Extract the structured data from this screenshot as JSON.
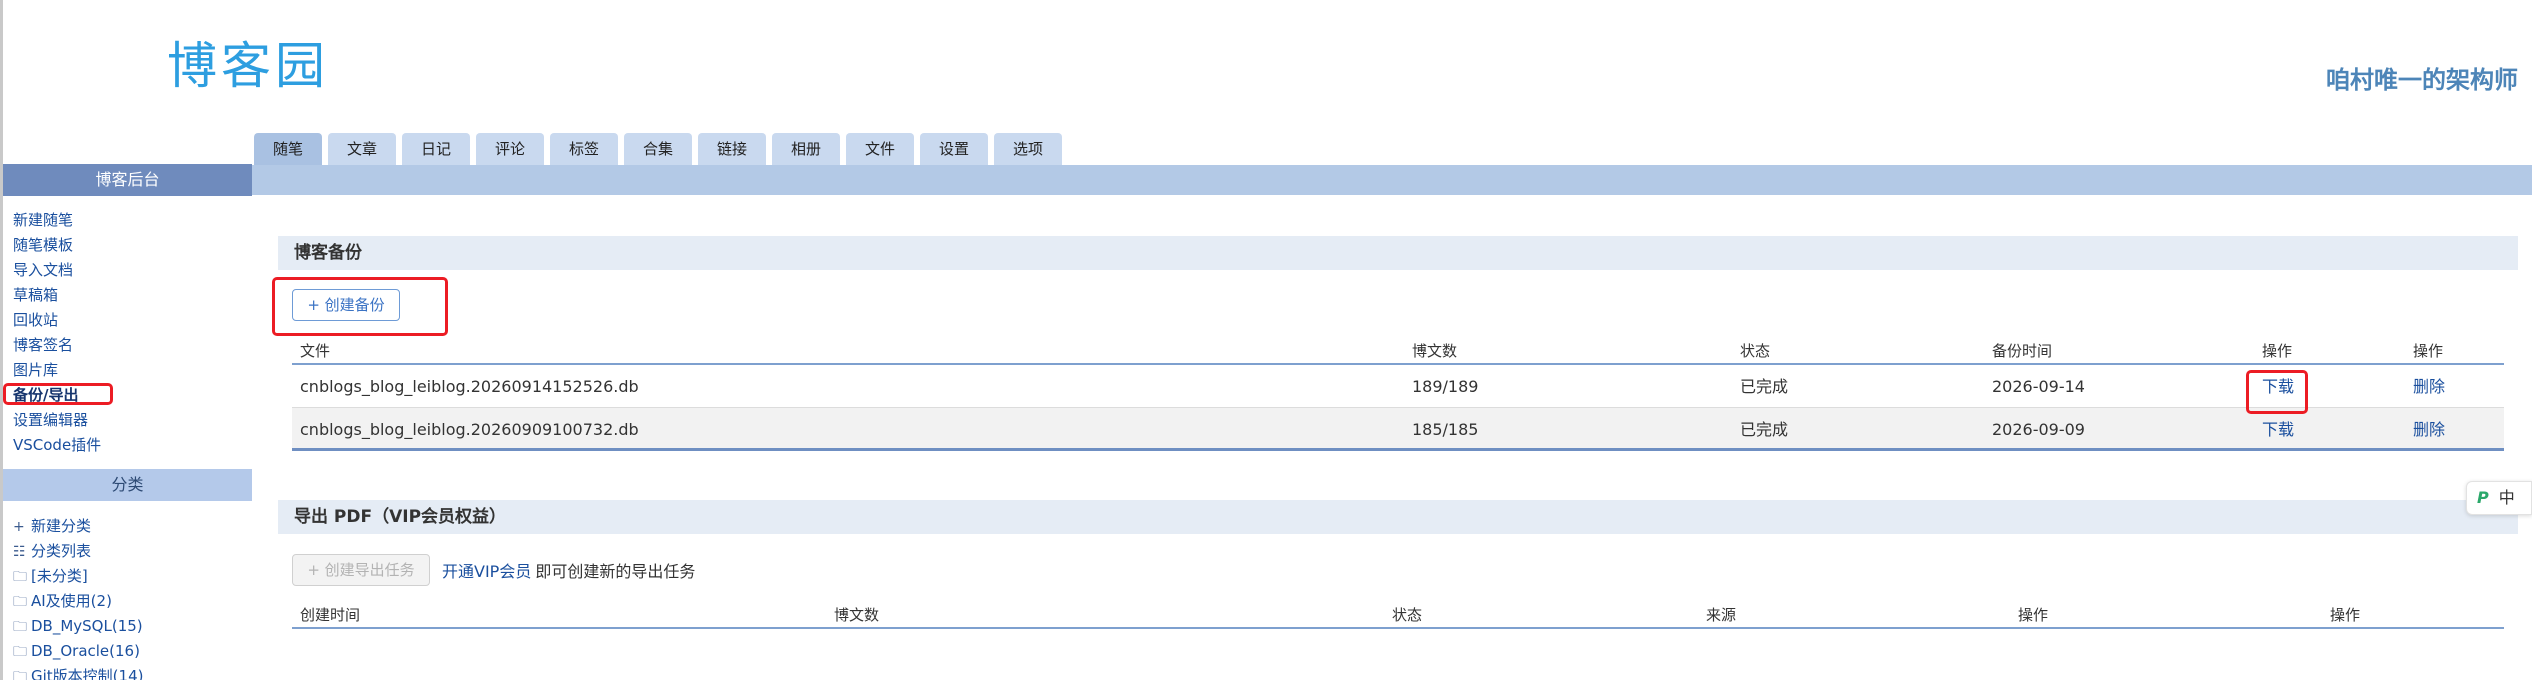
{
  "header": {
    "logo_text": "博客园",
    "blog_name": "咱村唯一的架构师"
  },
  "tabs": [
    {
      "label": "随笔",
      "active": true
    },
    {
      "label": "文章"
    },
    {
      "label": "日记"
    },
    {
      "label": "评论"
    },
    {
      "label": "标签"
    },
    {
      "label": "合集"
    },
    {
      "label": "链接"
    },
    {
      "label": "相册"
    },
    {
      "label": "文件"
    },
    {
      "label": "设置"
    },
    {
      "label": "选项"
    }
  ],
  "sidebar": {
    "admin_title": "博客后台",
    "admin_items": [
      "新建随笔",
      "随笔模板",
      "导入文档",
      "草稿箱",
      "回收站",
      "博客签名",
      "图片库",
      "备份/导出",
      "设置编辑器",
      "VSCode插件"
    ],
    "category_title": "分类",
    "category_items": [
      {
        "icon": "plus-icon",
        "glyph": "+",
        "label": "新建分类"
      },
      {
        "icon": "list-icon",
        "glyph": "☷",
        "label": "分类列表"
      },
      {
        "icon": "folder-icon",
        "glyph": "🗀",
        "label": "[未分类]"
      },
      {
        "icon": "folder-icon",
        "glyph": "🗀",
        "label": "AI及使用(2)"
      },
      {
        "icon": "folder-icon",
        "glyph": "🗀",
        "label": "DB_MySQL(15)"
      },
      {
        "icon": "folder-icon",
        "glyph": "🗀",
        "label": "DB_Oracle(16)"
      },
      {
        "icon": "folder-icon",
        "glyph": "🗀",
        "label": "Git版本控制(14)"
      }
    ]
  },
  "backup": {
    "title": "博客备份",
    "create_button": "+ 创建备份",
    "columns": [
      "文件",
      "博文数",
      "状态",
      "备份时间",
      "操作",
      "操作"
    ],
    "rows": [
      {
        "file": "cnblogs_blog_leiblog.20260914152526.db",
        "count": "189/189",
        "status": "已完成",
        "time": "2026-09-14",
        "download": "下载",
        "delete": "删除"
      },
      {
        "file": "cnblogs_blog_leiblog.20260909100732.db",
        "count": "185/185",
        "status": "已完成",
        "time": "2026-09-09",
        "download": "下载",
        "delete": "删除"
      }
    ]
  },
  "pdf": {
    "title": "导出 PDF（VIP会员权益）",
    "create_button": "+ 创建导出任务",
    "vip_link": "开通VIP会员",
    "vip_text": "即可创建新的导出任务",
    "columns": [
      "创建时间",
      "博文数",
      "状态",
      "来源",
      "操作",
      "操作"
    ]
  },
  "float_widget": {
    "logo_glyph": "P",
    "lang": "中"
  },
  "colors": {
    "accent": "#2d9ee0",
    "sidebar_header": "#6f8bbd",
    "tab": "#c9d9ef",
    "highlight": "#ec1c24",
    "link": "#1a4f9e"
  }
}
